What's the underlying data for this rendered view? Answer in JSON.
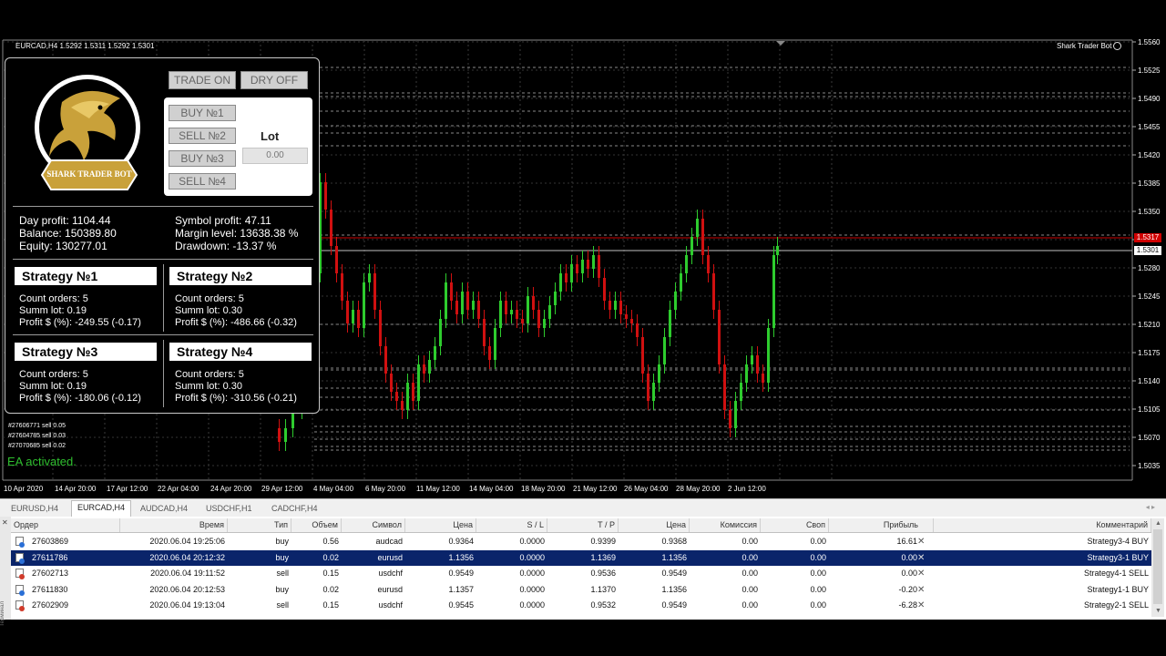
{
  "chart": {
    "symbol_title": "EURCAD,H4  1.5292 1.5311 1.5292 1.5301",
    "bot_label": "Shark Trader Bot",
    "price_levels": [
      "1.5560",
      "1.5525",
      "1.5490",
      "1.5455",
      "1.5420",
      "1.5385",
      "1.5350",
      "1.5315",
      "1.5280",
      "1.5245",
      "1.5210",
      "1.5175",
      "1.5140",
      "1.5105",
      "1.5070",
      "1.5035"
    ],
    "ask_tag": "1.5317",
    "bid_tag": "1.5301",
    "date_labels": [
      "10 Apr 2020",
      "14 Apr 20:00",
      "17 Apr 12:00",
      "22 Apr 04:00",
      "24 Apr 20:00",
      "29 Apr 12:00",
      "4 May 04:00",
      "6 May 20:00",
      "11 May 12:00",
      "14 May 04:00",
      "18 May 20:00",
      "21 May 12:00",
      "26 May 04:00",
      "28 May 20:00",
      "2 Jun 12:00"
    ],
    "ea_status": "EA activated.",
    "order_labels": [
      "#27606771 sell 0.05",
      "#27604785 sell 0.03",
      "#27070685 sell 0.02"
    ],
    "colors": {
      "bull": "#2ecc2e",
      "bear": "#d01010",
      "bid_line": "#c0c0c0",
      "ask_line": "#cc0000",
      "dash_line": "#888888"
    }
  },
  "panel": {
    "logo_text": "SHARK TRADER BOT",
    "trade_button": "TRADE ON",
    "dry_button": "DRY OFF",
    "order_buttons": [
      "BUY №1",
      "SELL №2",
      "BUY №3",
      "SELL №4"
    ],
    "lot_label": "Lot",
    "lot_value": "0.00",
    "day_profit": "Day profit: 1104.44",
    "balance": "Balance: 150389.80",
    "equity": "Equity: 130277.01",
    "symbol_profit": "Symbol profit: 47.11",
    "margin_level": "Margin level: 13638.38 %",
    "drawdown": "Drawdown: -13.37 %",
    "strategies": [
      {
        "title": "Strategy №1",
        "count": "Count orders: 5",
        "lot": "Summ lot: 0.19",
        "profit": "Profit $ (%): -249.55 (-0.17)"
      },
      {
        "title": "Strategy №2",
        "count": "Count orders: 5",
        "lot": "Summ lot: 0.30",
        "profit": "Profit $ (%): -486.66 (-0.32)"
      },
      {
        "title": "Strategy №3",
        "count": "Count orders: 5",
        "lot": "Summ lot: 0.19",
        "profit": "Profit $ (%): -180.06 (-0.12)"
      },
      {
        "title": "Strategy №4",
        "count": "Count orders: 5",
        "lot": "Summ lot: 0.30",
        "profit": "Profit $ (%): -310.56 (-0.21)"
      }
    ]
  },
  "tabs": [
    "EURUSD,H4",
    "EURCAD,H4",
    "AUDCAD,H4",
    "USDCHF,H1",
    "CADCHF,H4"
  ],
  "active_tab": "EURCAD,H4",
  "terminal_label": "Терминал",
  "table": {
    "columns": [
      "Ордер",
      "Время",
      "Тип",
      "Объем",
      "Символ",
      "Цена",
      "S / L",
      "T / P",
      "Цена",
      "Комиссия",
      "Своп",
      "Прибыль",
      "Комментарий"
    ],
    "rows": [
      {
        "order": "27603869",
        "time": "2020.06.04 19:25:06",
        "type": "buy",
        "volume": "0.56",
        "symbol": "audcad",
        "price": "0.9364",
        "sl": "0.0000",
        "tp": "0.9399",
        "cur": "0.9368",
        "commission": "0.00",
        "swap": "0.00",
        "profit": "16.61",
        "comment": "Strategy3-4 BUY",
        "selected": false
      },
      {
        "order": "27611786",
        "time": "2020.06.04 20:12:32",
        "type": "buy",
        "volume": "0.02",
        "symbol": "eurusd",
        "price": "1.1356",
        "sl": "0.0000",
        "tp": "1.1369",
        "cur": "1.1356",
        "commission": "0.00",
        "swap": "0.00",
        "profit": "0.00",
        "comment": "Strategy3-1 BUY",
        "selected": true
      },
      {
        "order": "27602713",
        "time": "2020.06.04 19:11:52",
        "type": "sell",
        "volume": "0.15",
        "symbol": "usdchf",
        "price": "0.9549",
        "sl": "0.0000",
        "tp": "0.9536",
        "cur": "0.9549",
        "commission": "0.00",
        "swap": "0.00",
        "profit": "0.00",
        "comment": "Strategy4-1 SELL",
        "selected": false
      },
      {
        "order": "27611830",
        "time": "2020.06.04 20:12:53",
        "type": "buy",
        "volume": "0.02",
        "symbol": "eurusd",
        "price": "1.1357",
        "sl": "0.0000",
        "tp": "1.1370",
        "cur": "1.1356",
        "commission": "0.00",
        "swap": "0.00",
        "profit": "-0.20",
        "comment": "Strategy1-1 BUY",
        "selected": false
      },
      {
        "order": "27602909",
        "time": "2020.06.04 19:13:04",
        "type": "sell",
        "volume": "0.15",
        "symbol": "usdchf",
        "price": "0.9545",
        "sl": "0.0000",
        "tp": "0.9532",
        "cur": "0.9549",
        "commission": "0.00",
        "swap": "0.00",
        "profit": "-6.28",
        "comment": "Strategy2-1 SELL",
        "selected": false
      }
    ]
  }
}
